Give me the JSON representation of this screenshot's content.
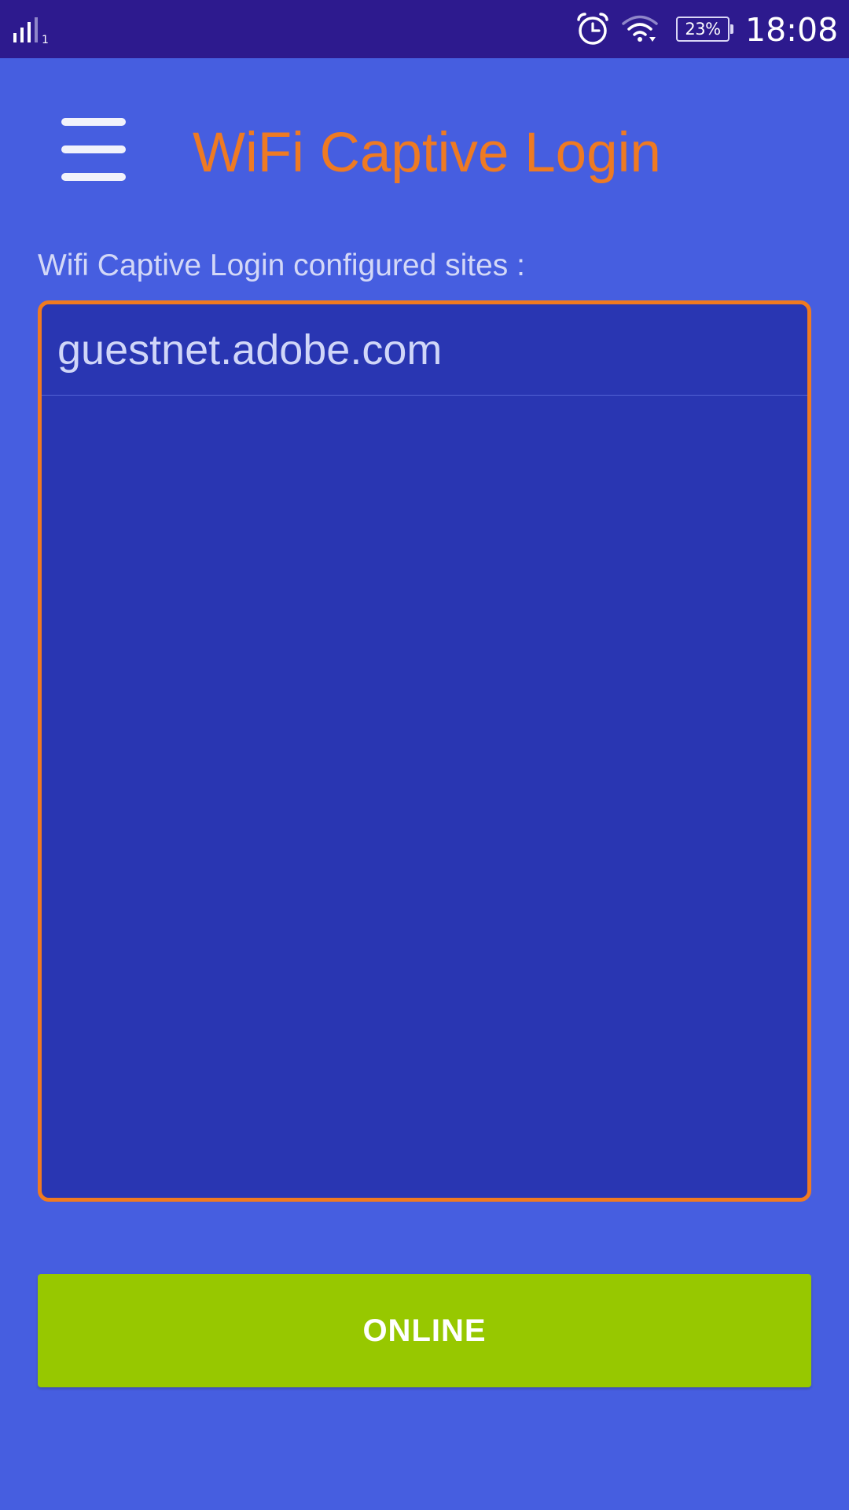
{
  "status_bar": {
    "signal_icon": "cellular-signal-icon",
    "signal_sim_label": "1",
    "alarm_icon": "alarm-clock-icon",
    "wifi_icon": "wifi-icon",
    "battery_level": "23%",
    "time": "18:08"
  },
  "header": {
    "menu_icon": "hamburger-menu-icon",
    "title": "WiFi Captive Login"
  },
  "main": {
    "section_label": "Wifi Captive Login configured sites :",
    "sites": [
      {
        "label": "guestnet.adobe.com"
      }
    ],
    "status_button_label": "ONLINE"
  },
  "colors": {
    "background": "#465ee0",
    "status_bar": "#2d1a8e",
    "title_accent": "#ee7a23",
    "list_border": "#f07a20",
    "list_background": "#2936b2",
    "online_button": "#97c800"
  }
}
